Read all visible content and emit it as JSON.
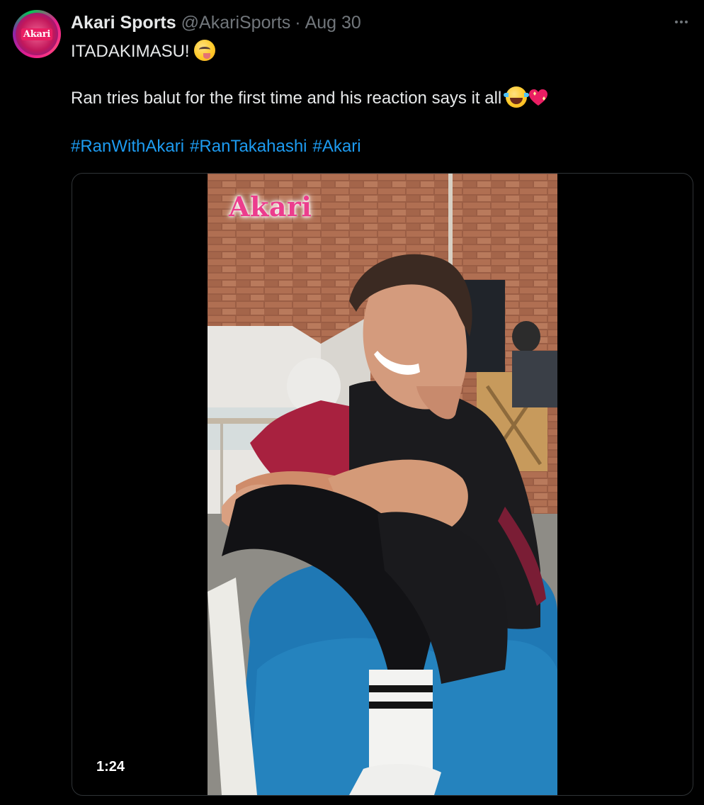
{
  "account": {
    "display_name": "Akari Sports",
    "handle": "@AkariSports",
    "separator": "·",
    "date": "Aug 30",
    "avatar_text": "Akari"
  },
  "tweet": {
    "line1": "ITADAKIMASU!",
    "line1_emoji": "face-savoring-food-icon",
    "line2": "Ran tries balut for the first time and his reaction says it all",
    "line2_emojis": [
      "face-with-tears-of-joy-icon",
      "sparkling-heart-icon"
    ],
    "hashtags": [
      "#RanWithAkari",
      "#RanTakahashi",
      "#Akari"
    ]
  },
  "media": {
    "type": "video",
    "watermark": "Akari",
    "duration": "1:24"
  },
  "colors": {
    "background": "#000000",
    "text": "#e7e9ea",
    "muted": "#71767b",
    "link": "#1d9bf0",
    "border": "#2f3336",
    "watermark": "#ec3d8d"
  }
}
